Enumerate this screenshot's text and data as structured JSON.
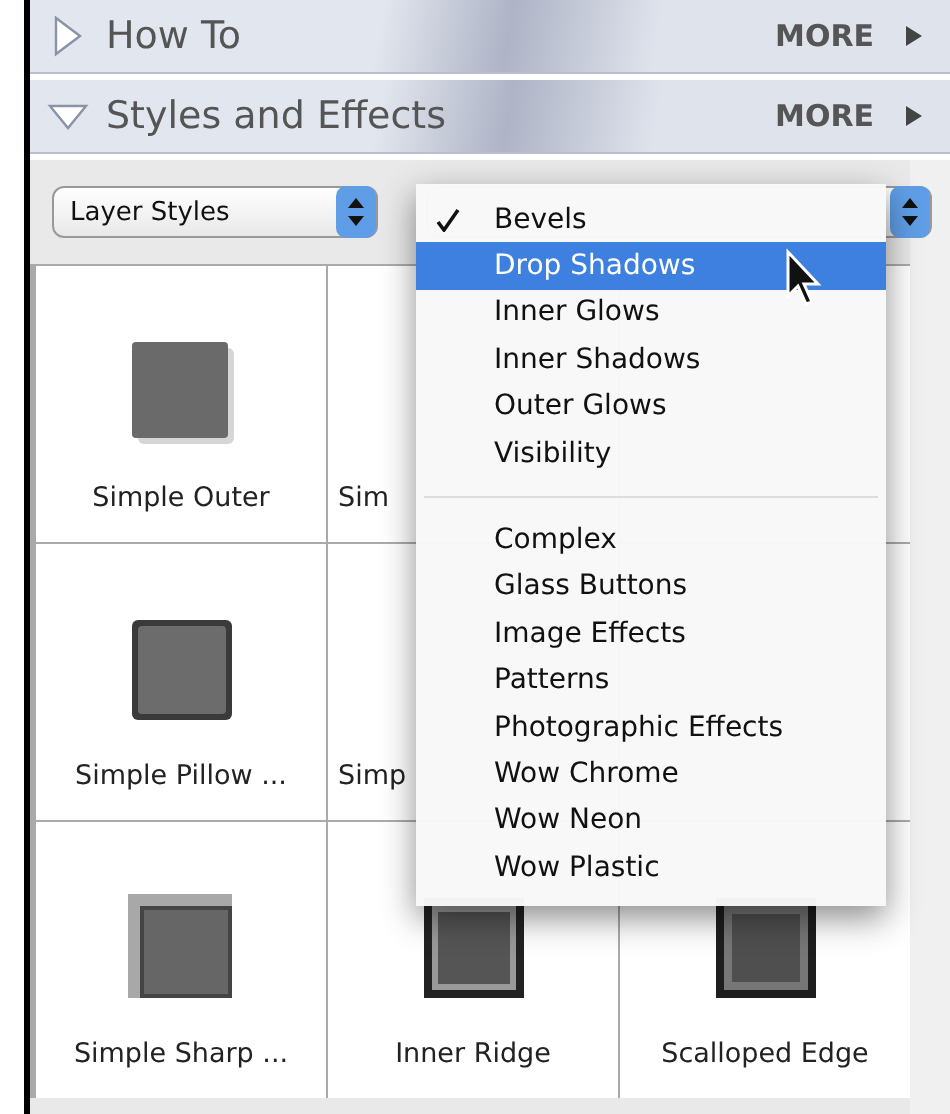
{
  "sections": [
    {
      "title": "How To",
      "expanded": false,
      "more": "MORE"
    },
    {
      "title": "Styles and Effects",
      "expanded": true,
      "more": "MORE"
    }
  ],
  "toolbar": {
    "type_select": "Layer Styles"
  },
  "grid": [
    {
      "label": "Simple Outer",
      "kind": "outer"
    },
    {
      "label": "Sim",
      "kind": "covered"
    },
    {
      "kind": "covered"
    },
    {
      "label": "Simple Pillow ...",
      "kind": "pillow"
    },
    {
      "label": "Simp",
      "kind": "covered"
    },
    {
      "kind": "covered"
    },
    {
      "label": "Simple Sharp ...",
      "kind": "sharp"
    },
    {
      "label": "Inner Ridge",
      "kind": "ridge"
    },
    {
      "label": "Scalloped Edge",
      "kind": "scalloped"
    }
  ],
  "menu": {
    "groups": [
      [
        {
          "label": "Bevels",
          "checked": true,
          "selected": false
        },
        {
          "label": "Drop Shadows",
          "checked": false,
          "selected": true
        },
        {
          "label": "Inner Glows",
          "checked": false,
          "selected": false
        },
        {
          "label": "Inner Shadows",
          "checked": false,
          "selected": false
        },
        {
          "label": "Outer Glows",
          "checked": false,
          "selected": false
        },
        {
          "label": "Visibility",
          "checked": false,
          "selected": false
        }
      ],
      [
        {
          "label": "Complex",
          "checked": false,
          "selected": false
        },
        {
          "label": "Glass Buttons",
          "checked": false,
          "selected": false
        },
        {
          "label": "Image Effects",
          "checked": false,
          "selected": false
        },
        {
          "label": "Patterns",
          "checked": false,
          "selected": false
        },
        {
          "label": "Photographic Effects",
          "checked": false,
          "selected": false
        },
        {
          "label": "Wow Chrome",
          "checked": false,
          "selected": false
        },
        {
          "label": "Wow Neon",
          "checked": false,
          "selected": false
        },
        {
          "label": "Wow Plastic",
          "checked": false,
          "selected": false
        }
      ]
    ]
  }
}
